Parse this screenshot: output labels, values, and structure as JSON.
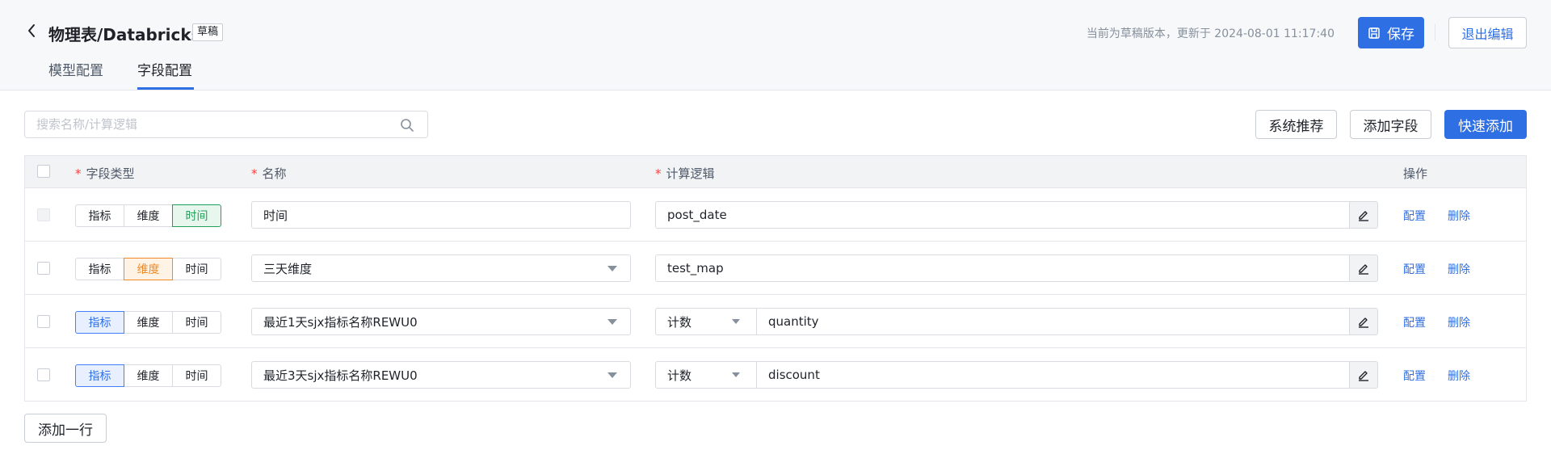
{
  "header": {
    "title": "物理表/Databricks",
    "draft_badge": "草稿",
    "status": "当前为草稿版本，更新于 2024-08-01 11:17:40",
    "save_label": "保存",
    "exit_label": "退出编辑"
  },
  "tabs": [
    {
      "label": "模型配置",
      "active": false
    },
    {
      "label": "字段配置",
      "active": true
    }
  ],
  "toolbar": {
    "search_placeholder": "搜索名称/计算逻辑",
    "recommend_label": "系统推荐",
    "add_field_label": "添加字段",
    "quick_add_label": "快速添加"
  },
  "table": {
    "columns": [
      "字段类型",
      "名称",
      "计算逻辑",
      "操作"
    ],
    "type_options": [
      "指标",
      "维度",
      "时间"
    ],
    "rows": [
      {
        "type": "时间",
        "name": "时间",
        "agg": "",
        "logic": "post_date",
        "config": "配置",
        "delete": "删除"
      },
      {
        "type": "维度",
        "name": "三天维度",
        "agg": "",
        "logic": "test_map",
        "config": "配置",
        "delete": "删除"
      },
      {
        "type": "指标",
        "name": "最近1天sjx指标名称REWU0",
        "agg": "计数",
        "logic": "quantity",
        "config": "配置",
        "delete": "删除"
      },
      {
        "type": "指标",
        "name": "最近3天sjx指标名称REWU0",
        "agg": "计数",
        "logic": "discount",
        "config": "配置",
        "delete": "删除"
      }
    ]
  },
  "add_row_label": "添加一行",
  "colors": {
    "primary": "#2f6fe4",
    "time": "#22a05a",
    "dimension": "#f08a24",
    "metric": "#2f6fe4",
    "required": "#f53f3f"
  }
}
